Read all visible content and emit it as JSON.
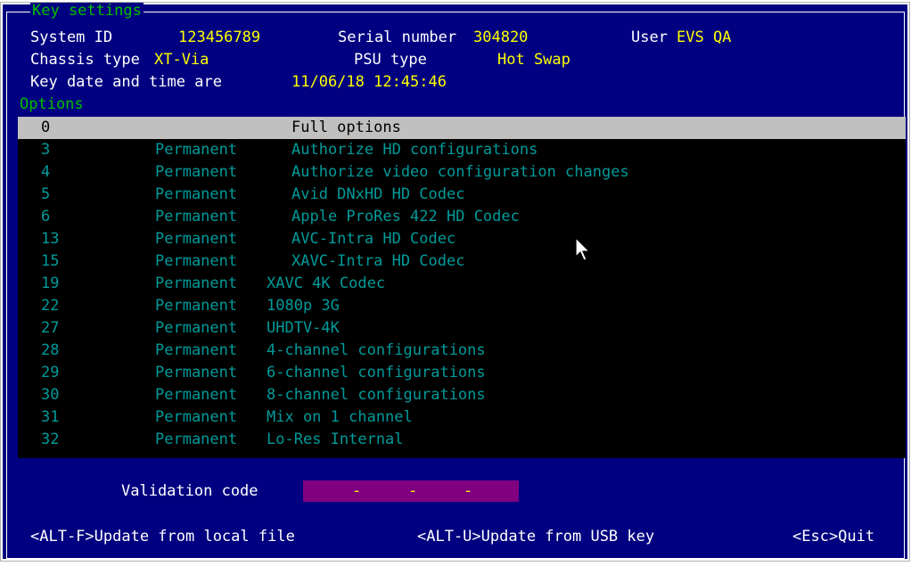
{
  "key_settings": {
    "legend": "Key settings",
    "system_id_label": "System ID",
    "system_id": "123456789",
    "serial_label": "Serial number",
    "serial": "304820",
    "user_label": "User",
    "user": "EVS QA",
    "chassis_label": "Chassis type",
    "chassis": "XT-Via",
    "psu_label": "PSU type",
    "psu": "Hot Swap",
    "key_date_label": "Key date and time are",
    "key_date": "11/06/18 12:45:46"
  },
  "options": {
    "legend": "Options",
    "rows": [
      {
        "num": "0",
        "status": "",
        "name": "Full options"
      },
      {
        "num": "3",
        "status": "Permanent",
        "name": "Authorize HD configurations"
      },
      {
        "num": "4",
        "status": "Permanent",
        "name": "Authorize video configuration changes"
      },
      {
        "num": "5",
        "status": "Permanent",
        "name": "Avid DNxHD HD Codec"
      },
      {
        "num": "6",
        "status": "Permanent",
        "name": "Apple ProRes 422 HD Codec"
      },
      {
        "num": "13",
        "status": "Permanent",
        "name": "AVC-Intra HD Codec"
      },
      {
        "num": "15",
        "status": "Permanent",
        "name": "XAVC-Intra HD Codec"
      },
      {
        "num": "19",
        "status": "Permanent",
        "name": "XAVC 4K Codec"
      },
      {
        "num": "22",
        "status": "Permanent",
        "name": "1080p 3G"
      },
      {
        "num": "27",
        "status": "Permanent",
        "name": "UHDTV-4K"
      },
      {
        "num": "28",
        "status": "Permanent",
        "name": "4-channel configurations"
      },
      {
        "num": "29",
        "status": "Permanent",
        "name": "6-channel configurations"
      },
      {
        "num": "30",
        "status": "Permanent",
        "name": "8-channel configurations"
      },
      {
        "num": "31",
        "status": "Permanent",
        "name": "Mix on 1 channel"
      },
      {
        "num": "32",
        "status": "Permanent",
        "name": "Lo-Res Internal"
      }
    ]
  },
  "validation": {
    "label": "Validation code",
    "dashes": [
      "-",
      "-",
      "-"
    ]
  },
  "footer": {
    "update_file": "<ALT-F>Update from local file",
    "update_usb": "<ALT-U>Update from USB key",
    "quit": "<Esc>Quit"
  },
  "colors": {
    "background": "#000080",
    "highlight_value": "#ffff00",
    "option_text": "#009a9a",
    "legend": "#00c000",
    "validation_field": "#800080"
  }
}
